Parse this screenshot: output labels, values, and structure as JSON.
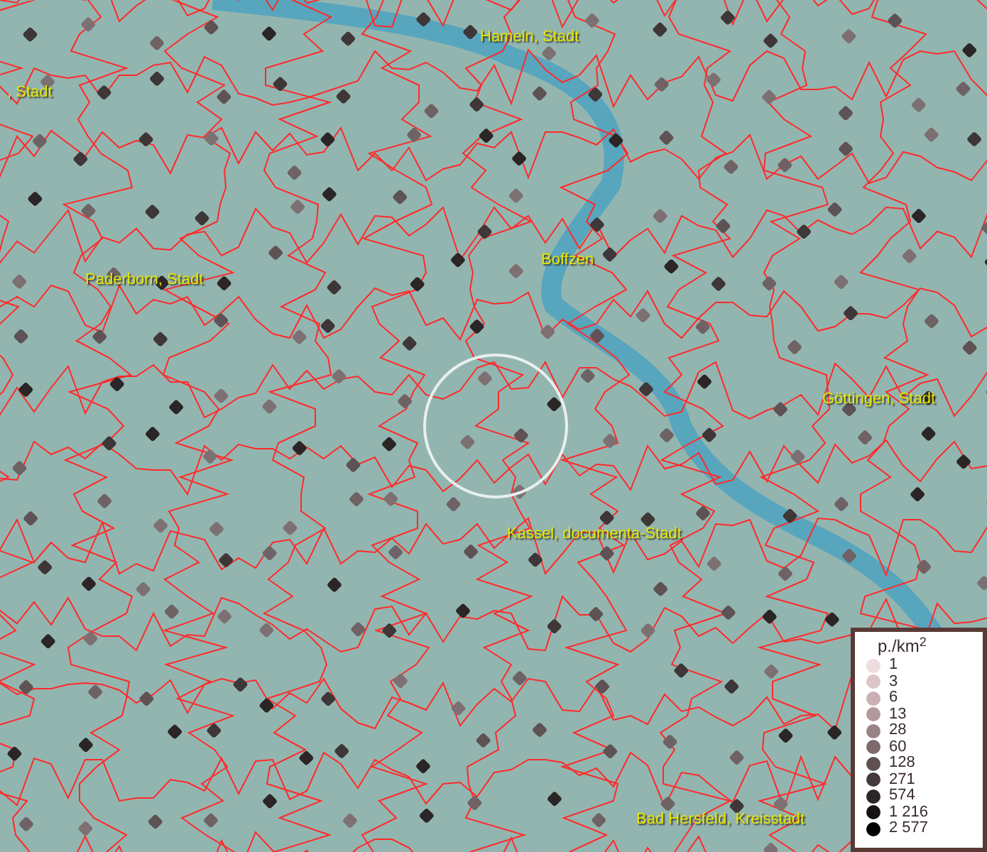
{
  "map": {
    "places": [
      {
        "name": "Hameln, Stadt"
      },
      {
        "name": ", Stadt"
      },
      {
        "name": "Paderborn, Stadt"
      },
      {
        "name": "Boffzen"
      },
      {
        "name": "Göttingen, Stadt"
      },
      {
        "name": "Kassel, documenta-Stadt"
      },
      {
        "name": "Bad Hersfeld, Kreisstadt"
      }
    ]
  },
  "legend": {
    "title": "p./km$^{2}$",
    "items": [
      {
        "label": "1",
        "color": "#efdcde"
      },
      {
        "label": "3",
        "color": "#ddc6c8"
      },
      {
        "label": "6",
        "color": "#c8b0b3"
      },
      {
        "label": "13",
        "color": "#b29a9c"
      },
      {
        "label": "28",
        "color": "#9a8385"
      },
      {
        "label": "60",
        "color": "#7d6a6c"
      },
      {
        "label": "128",
        "color": "#5f5052"
      },
      {
        "label": "271",
        "color": "#443a3b"
      },
      {
        "label": "574",
        "color": "#2b2526"
      },
      {
        "label": "1 216",
        "color": "#161213"
      },
      {
        "label": "2 577",
        "color": "#000000"
      }
    ]
  }
}
